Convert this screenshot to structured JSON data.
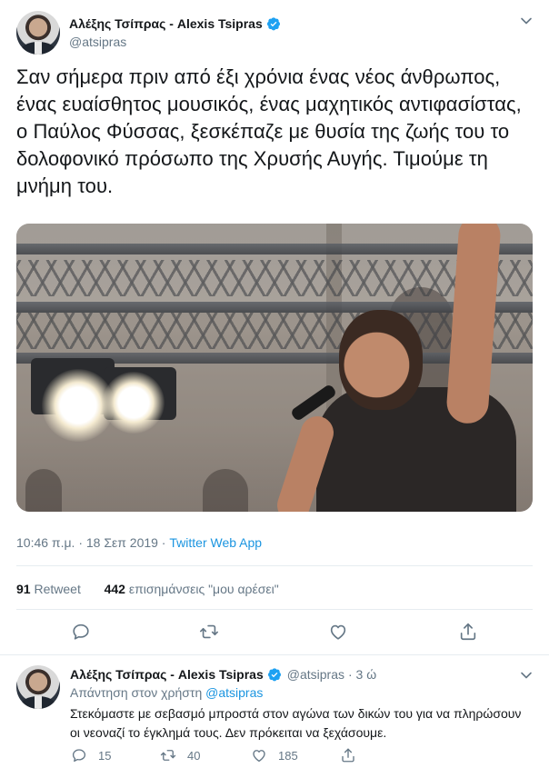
{
  "main_tweet": {
    "display_name": "Αλέξης Τσίπρας - Alexis Tsipras",
    "handle": "@atsipras",
    "text": "Σαν σήμερα πριν από έξι χρόνια ένας νέος άνθρωπος, ένας ευαίσθητος μουσικός, ένας μαχητικός αντιφασίστας, ο Παύλος Φύσσας, ξεσκέπαζε με θυσία της ζωής του το δολοφονικό πρόσωπο της Χρυσής Αυγής. Τιμούμε τη μνήμη του.",
    "timestamp": "10:46 π.μ. · 18 Σεπ 2019 · ",
    "source_app": "Twitter Web App",
    "retweet_count": "91",
    "retweet_label": "Retweet",
    "like_count": "442",
    "like_label": "επισημάνσεις \"μου αρέσει\"",
    "icons": [
      "verified-icon",
      "chevron-down-icon",
      "reply-icon",
      "retweet-icon",
      "like-icon",
      "share-icon"
    ]
  },
  "reply_tweet": {
    "display_name": "Αλέξης Τσίπρας - Alexis Tsipras",
    "handle": "@atsipras",
    "time": "· 3 ώ",
    "reply_prefix": "Απάντηση στον χρήστη ",
    "reply_mention": "@atsipras",
    "text": "Στεκόμαστε με σεβασμό μπροστά στον αγώνα των δικών του για να πληρώσουν οι νεοναζί το έγκλημά τους. Δεν πρόκειται να ξεχάσουμε.",
    "reply_count": "15",
    "retweet_count": "40",
    "like_count": "185"
  },
  "colors": {
    "text": "#14171a",
    "secondary": "#657786",
    "accent": "#1b95e0",
    "divider": "#e6ecf0"
  }
}
